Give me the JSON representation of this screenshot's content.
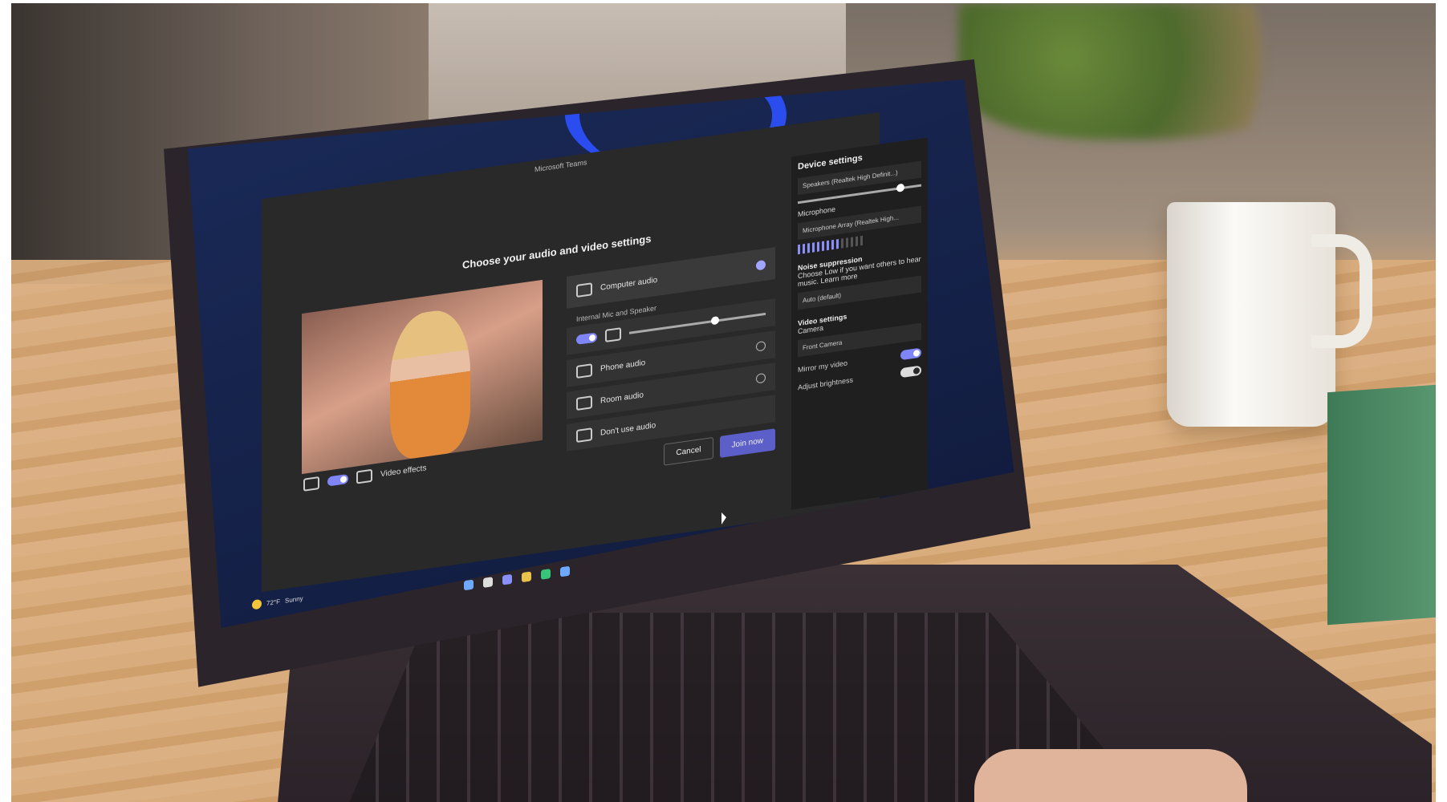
{
  "window": {
    "title": "Microsoft Teams"
  },
  "prejoin": {
    "heading": "Choose your audio and video settings",
    "video_effects_label": "Video effects",
    "audio_options": [
      {
        "label": "Computer audio",
        "selected": true
      },
      {
        "label": "Phone audio",
        "selected": false
      },
      {
        "label": "Room audio",
        "selected": false
      },
      {
        "label": "Don't use audio",
        "selected": false
      }
    ],
    "computer_audio_sub": "Internal Mic and Speaker",
    "speaker_volume_pct": 60,
    "cancel_label": "Cancel",
    "join_label": "Join now"
  },
  "device_settings": {
    "title": "Device settings",
    "speakers_value": "Speakers (Realtek High Definit...)",
    "speaker_volume_pct": 80,
    "microphone_label": "Microphone",
    "microphone_value": "Microphone Array (Realtek High...",
    "mic_level_active_bars": 9,
    "mic_level_total_bars": 14,
    "noise_suppression_label": "Noise suppression",
    "noise_suppression_help": "Choose Low if you want others to hear music. Learn more",
    "noise_suppression_value": "Auto (default)",
    "video_settings_label": "Video settings",
    "camera_label": "Camera",
    "camera_value": "Front Camera",
    "mirror_label": "Mirror my video",
    "mirror_on": true,
    "brightness_label": "Adjust brightness",
    "brightness_on": false
  },
  "taskbar": {
    "weather_temp": "72°F",
    "weather_desc": "Sunny"
  },
  "colors": {
    "accent": "#5b5fc7",
    "panel": "#292929",
    "wallpaper_swirl": "#2e52ff"
  }
}
